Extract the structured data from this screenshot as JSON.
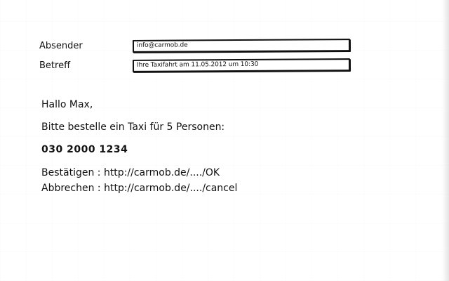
{
  "fields": {
    "sender_label": "Absender",
    "sender_value": "info@carmob.de",
    "subject_label": "Betreff",
    "subject_value": "Ihre Taxifahrt am 11.05.2012 um 10:30"
  },
  "message": {
    "greeting": "Hallo Max,",
    "request": "Bitte bestelle ein Taxi für 5 Personen:",
    "phone": "030 2000 1234",
    "confirm": "Bestätigen : http://carmob.de/..../OK",
    "cancel": "Abbrechen : http://carmob.de/..../cancel"
  }
}
